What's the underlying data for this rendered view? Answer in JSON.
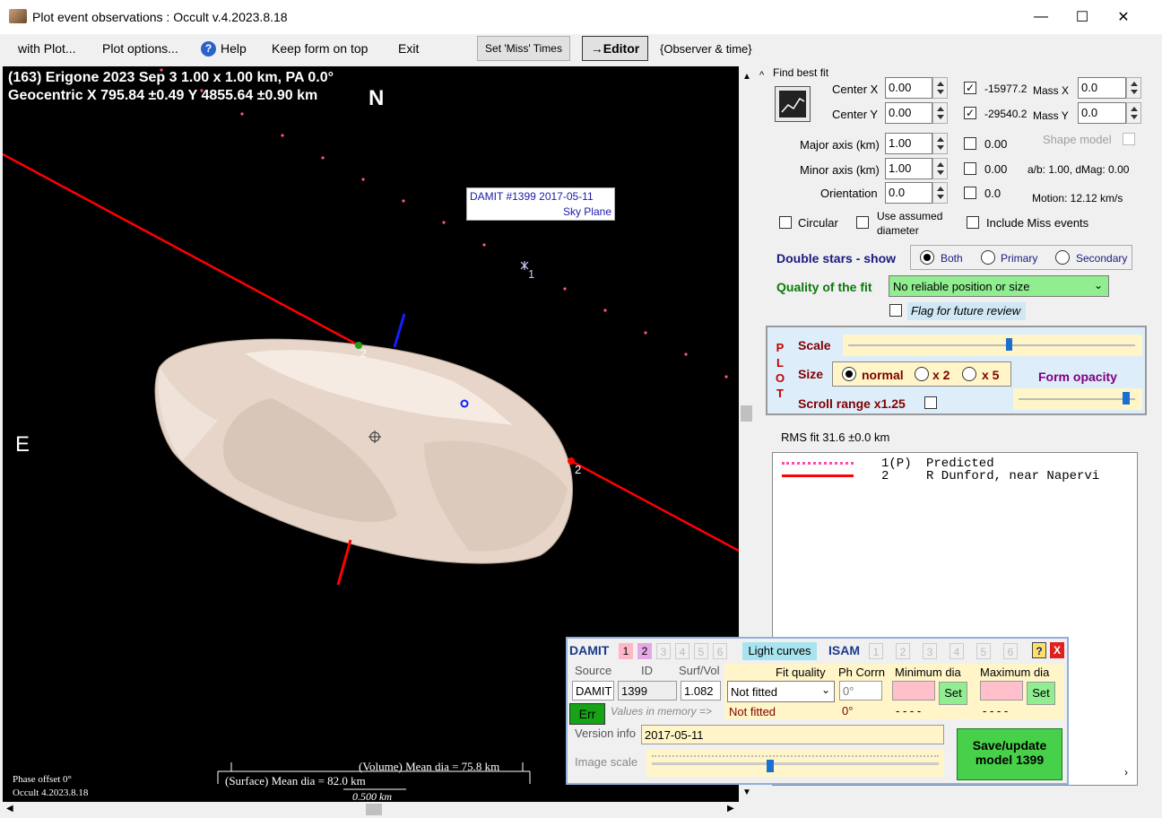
{
  "window": {
    "title": "Plot event observations : Occult v.4.2023.8.18",
    "minimize": "—",
    "maximize": "☐",
    "close": "✕"
  },
  "menu": {
    "with_plot": "with Plot...",
    "plot_options": "Plot options...",
    "help": "Help",
    "keep_on_top": "Keep form on top",
    "exit": "Exit",
    "set_miss_times": "Set 'Miss' Times",
    "editor": "→Editor",
    "observer_time": "{Observer & time}"
  },
  "plot": {
    "line1": "(163) Erigone  2023 Sep 3   1.00 x 1.00 km,  PA 0.0°",
    "line2": "Geocentric  X  795.84 ±0.49  Y 4855.64 ±0.90 km",
    "north": "N",
    "east": "E",
    "damit_label_1": "DAMIT #1399 2017-05-11",
    "damit_label_2": "Sky Plane",
    "marker_1": "1",
    "chord_label_a": "2",
    "chord_label_b": "2",
    "volume_dia": "(Volume) Mean dia = 75.8 km",
    "surface_dia": "(Surface) Mean dia = 82.0 km",
    "scale_bar": "0.500 km",
    "phase_offset": "Phase offset 0°",
    "version": "Occult 4.2023.8.18"
  },
  "fit": {
    "find_best_fit": "Find best fit",
    "center_x_label": "Center X",
    "center_x": "0.00",
    "center_y_label": "Center Y",
    "center_y": "0.00",
    "center_x_value": "-15977.2",
    "center_y_value": "-29540.2",
    "mass_x_label": "Mass X",
    "mass_x": "0.0",
    "mass_y_label": "Mass Y",
    "mass_y": "0.0",
    "major_label": "Major axis (km)",
    "major": "1.00",
    "major_value": "0.00",
    "minor_label": "Minor axis (km)",
    "minor": "1.00",
    "minor_value": "0.00",
    "orient_label": "Orientation",
    "orient": "0.0",
    "orient_value": "0.0",
    "shape_model": "Shape model",
    "ab_ratio": "a/b: 1.00, dMag: 0.00",
    "motion": "Motion: 12.12 km/s",
    "circular": "Circular",
    "use_assumed_1": "Use assumed",
    "use_assumed_2": "diameter",
    "include_miss": "Include Miss events",
    "double_stars": "Double stars - show",
    "both": "Both",
    "primary": "Primary",
    "secondary": "Secondary",
    "quality_label": "Quality of the fit",
    "quality_value": "No reliable position or size",
    "flag_review": "Flag for future review"
  },
  "plotopts": {
    "plot_letters": [
      "P",
      "L",
      "O",
      "T"
    ],
    "scale": "Scale",
    "size": "Size",
    "normal": "normal",
    "x2": "x 2",
    "x5": "x 5",
    "form_opacity": "Form opacity",
    "scroll_range": "Scroll range x1.25",
    "scale_level": 0.55,
    "opacity_level": 0.95
  },
  "rms": "RMS fit 31.6 ±0.0 km",
  "legend": [
    {
      "num": "1(P)",
      "text": "Predicted"
    },
    {
      "num": "2",
      "text": "R Dunford, near Napervi"
    }
  ],
  "damit": {
    "title": "DAMIT",
    "nums": [
      "1",
      "2",
      "3",
      "4",
      "5",
      "6"
    ],
    "light_curves": "Light curves",
    "isam": "ISAM",
    "isam_nums": [
      "1",
      "2",
      "3",
      "4",
      "5",
      "6"
    ],
    "help": "?",
    "close": "X",
    "source_label": "Source",
    "id_label": "ID",
    "surfvol_label": "Surf/Vol",
    "source": "DAMIT",
    "id": "1399",
    "surfvol": "1.082",
    "fit_quality_label": "Fit quality",
    "fit_quality": "Not fitted",
    "fit_quality_mem": "Not fitted",
    "ph_corr_label": "Ph Corrn",
    "ph_corr": "0°",
    "ph_corr_mem": "0°",
    "min_dia_label": "Minimum dia",
    "max_dia_label": "Maximum dia",
    "set": "Set",
    "dashes": "- - - -",
    "err": "Err",
    "values_mem": "Values in memory =>",
    "version_label": "Version info",
    "version": "2017-05-11",
    "image_scale_label": "Image scale",
    "image_scale_level": 0.4,
    "save_1": "Save/update",
    "save_2": "model 1399"
  },
  "colors": {
    "chord_red": "#ff0000",
    "blue_mark": "#1020ff",
    "asteroid": "#e8d8cc",
    "pred_dots": "#ff4da6",
    "label_blue": "#1a1aa8",
    "quality_green": "#90ee90"
  }
}
